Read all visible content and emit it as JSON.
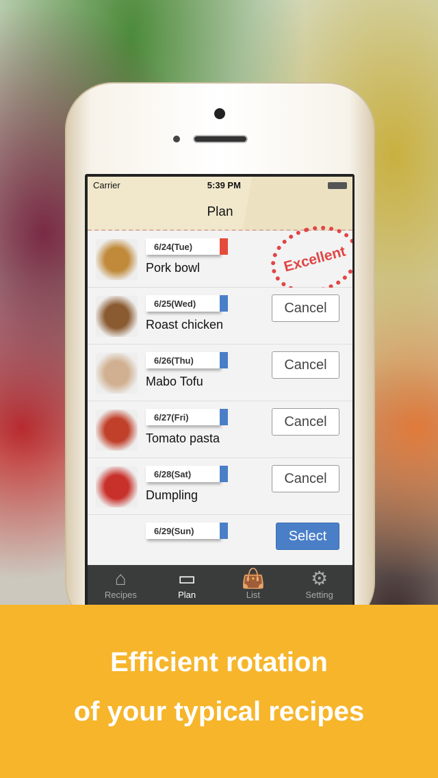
{
  "status": {
    "carrier": "Carrier",
    "time": "5:39 PM"
  },
  "header": {
    "title": "Plan"
  },
  "rows": [
    {
      "date": "6/24(Tue)",
      "name": "Pork bowl",
      "flag": "#e54b3c",
      "stamp": "Excellent",
      "thumb": "#c08a3a"
    },
    {
      "date": "6/25(Wed)",
      "name": "Roast chicken",
      "flag": "#4a7fc8",
      "button": "Cancel",
      "thumb": "#8a5a30"
    },
    {
      "date": "6/26(Thu)",
      "name": "Mabo Tofu",
      "flag": "#4a7fc8",
      "button": "Cancel",
      "thumb": "#d0b090"
    },
    {
      "date": "6/27(Fri)",
      "name": "Tomato pasta",
      "flag": "#4a7fc8",
      "button": "Cancel",
      "thumb": "#c0402a"
    },
    {
      "date": "6/28(Sat)",
      "name": "Dumpling",
      "flag": "#4a7fc8",
      "button": "Cancel",
      "thumb": "#c8302a"
    },
    {
      "date": "6/29(Sun)",
      "name": "",
      "flag": "#4a7fc8",
      "button": "Select"
    }
  ],
  "tabs": [
    {
      "label": "Recipes",
      "icon": "house-icon"
    },
    {
      "label": "Plan",
      "icon": "calendar-icon",
      "active": true
    },
    {
      "label": "List",
      "icon": "shopping-bag-icon"
    },
    {
      "label": "Setting",
      "icon": "gear-icon"
    }
  ],
  "banner": {
    "line1": "Efficient rotation",
    "line2": "of your typical recipes"
  }
}
